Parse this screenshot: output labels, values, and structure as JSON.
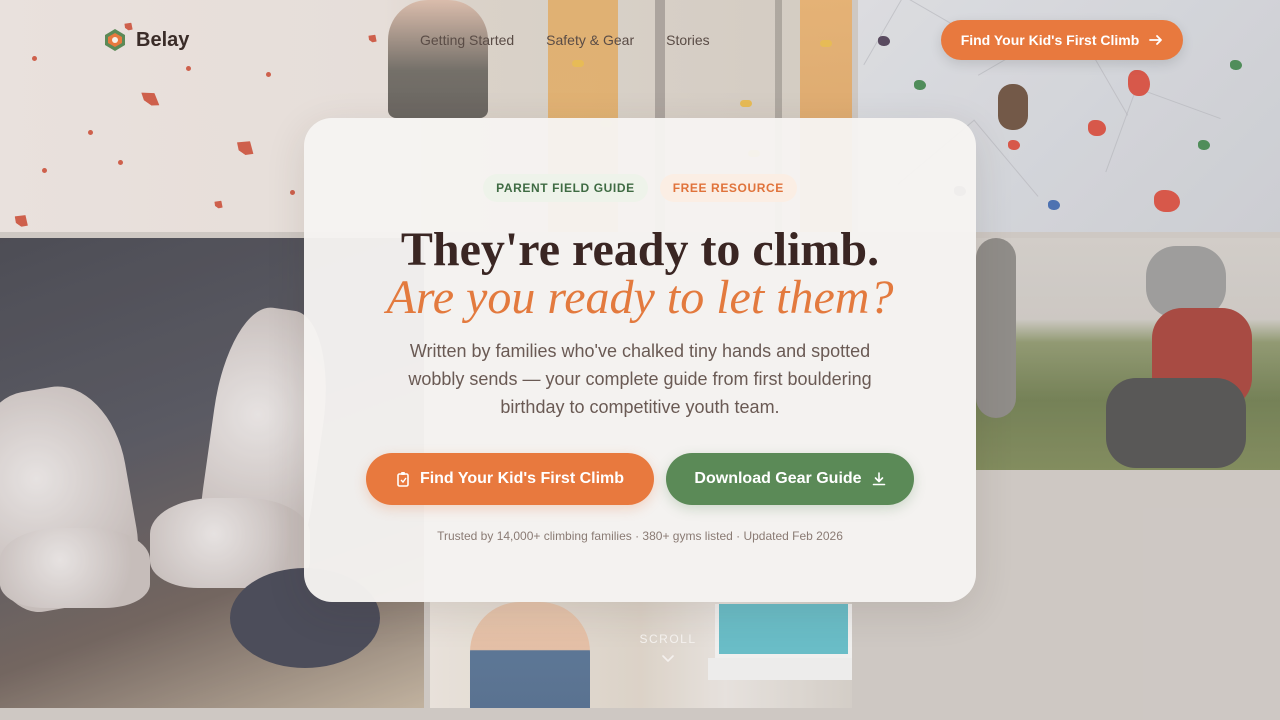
{
  "brand": {
    "name": "Belay",
    "accent": "#e8793e",
    "secondary": "#5b8a57",
    "dark": "#3a2623"
  },
  "nav": {
    "items": [
      "Getting Started",
      "Safety & Gear",
      "Stories"
    ]
  },
  "header_cta": {
    "label": "Find Your Kid's First Climb",
    "icon": "arrow-right-icon"
  },
  "hero": {
    "badges": {
      "guide": "PARENT FIELD GUIDE",
      "free": "FREE RESOURCE"
    },
    "headline_line1": "They're ready to climb.",
    "headline_line2": "Are you ready to let them?",
    "lead": "Written by families who've chalked tiny hands and spotted wobbly sends — your complete guide from first bouldering birthday to competitive youth team.",
    "primary_button": {
      "label": "Find Your Kid's First Climb",
      "icon": "clipboard-icon"
    },
    "secondary_button": {
      "label": "Download Gear Guide",
      "icon": "download-icon"
    },
    "trust_line": "Trusted by 14,000+ climbing families · 380+ gyms listed · Updated Feb 2026"
  },
  "scroll_hint": {
    "label": "SCROLL",
    "icon": "chevron-down-icon"
  }
}
